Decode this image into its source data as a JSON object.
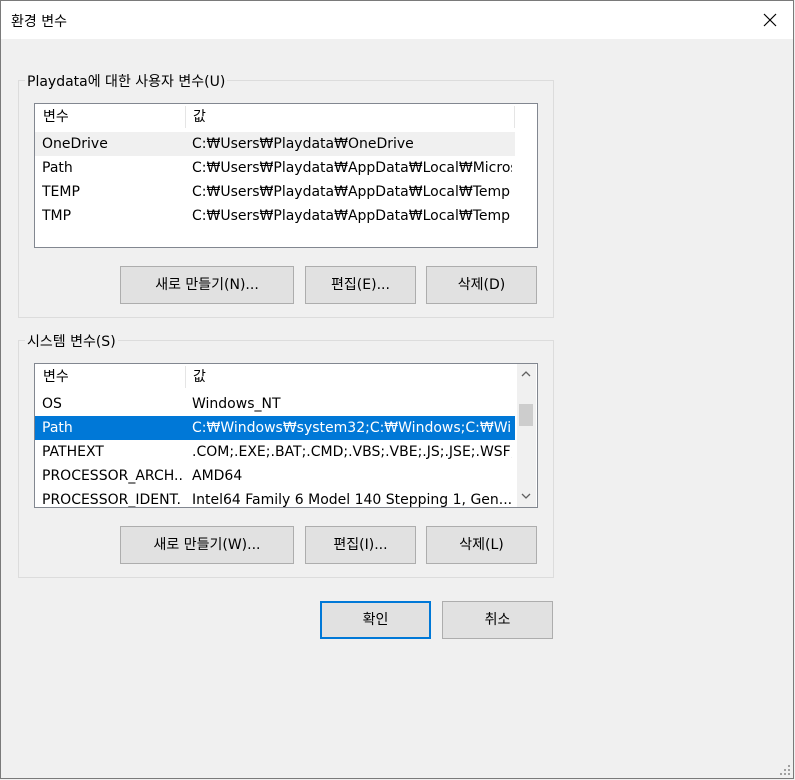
{
  "window": {
    "title": "환경 변수",
    "close_icon": "close-icon"
  },
  "user_vars": {
    "group_label": "Playdata에 대한 사용자 변수(U)",
    "headers": [
      "변수",
      "값"
    ],
    "rows": [
      {
        "name": "OneDrive",
        "value": "C:₩Users₩Playdata₩OneDrive"
      },
      {
        "name": "Path",
        "value": "C:₩Users₩Playdata₩AppData₩Local₩Micros..."
      },
      {
        "name": "TEMP",
        "value": "C:₩Users₩Playdata₩AppData₩Local₩Temp"
      },
      {
        "name": "TMP",
        "value": "C:₩Users₩Playdata₩AppData₩Local₩Temp"
      }
    ],
    "buttons": {
      "new": "새로 만들기(N)...",
      "edit": "편집(E)...",
      "delete": "삭제(D)"
    }
  },
  "system_vars": {
    "group_label": "시스템 변수(S)",
    "headers": [
      "변수",
      "값"
    ],
    "rows": [
      {
        "name": "OS",
        "value": "Windows_NT"
      },
      {
        "name": "Path",
        "value": "C:₩Windows₩system32;C:₩Windows;C:₩Win..."
      },
      {
        "name": "PATHEXT",
        "value": ".COM;.EXE;.BAT;.CMD;.VBS;.VBE;.JS;.JSE;.WSF;...."
      },
      {
        "name": "PROCESSOR_ARCH...",
        "value": "AMD64"
      },
      {
        "name": "PROCESSOR_IDENT...",
        "value": "Intel64 Family 6 Model 140 Stepping 1, Gen..."
      }
    ],
    "selected_row": "Path",
    "buttons": {
      "new": "새로 만들기(W)...",
      "edit": "편집(I)...",
      "delete": "삭제(L)"
    }
  },
  "footer": {
    "ok": "확인",
    "cancel": "취소"
  },
  "colors": {
    "selection": "#0078d7",
    "button_bg": "#e1e1e1",
    "window_bg": "#f0f0f0"
  }
}
